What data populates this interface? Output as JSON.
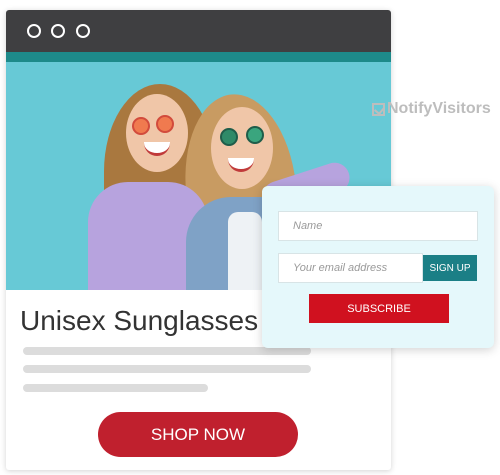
{
  "window": {
    "controls": [
      "circle-icon",
      "circle-icon",
      "circle-icon"
    ]
  },
  "hero": {
    "image_alt": "two women wearing sunglasses"
  },
  "product": {
    "title": "Unisex Sunglasses",
    "cta_label": "SHOP NOW"
  },
  "brand": {
    "name": "NotifyVisitors"
  },
  "signup": {
    "name_placeholder": "Name",
    "email_placeholder": "Your email address",
    "signup_label": "SIGN UP",
    "subscribe_label": "SUBSCRIBE"
  },
  "colors": {
    "titlebar": "#3f3f41",
    "accent_teal": "#1b7f86",
    "cta_red": "#c0202e",
    "popup_bg": "#e5f8fb"
  }
}
